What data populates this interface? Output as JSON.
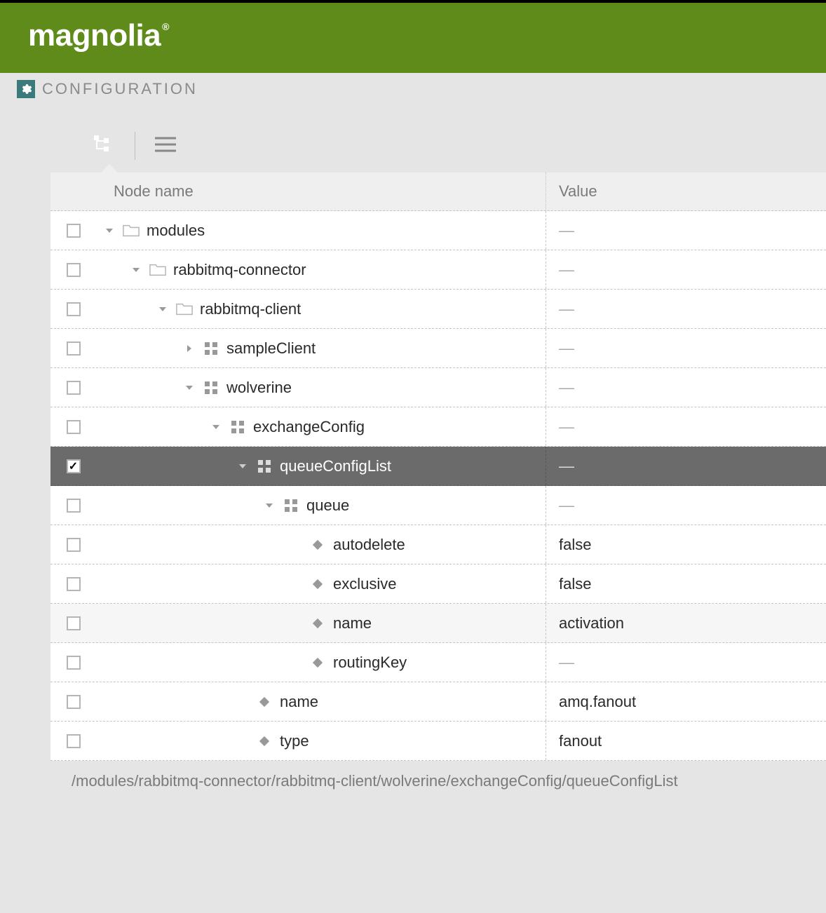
{
  "header": {
    "brand": "magnolia",
    "section_title": "CONFIGURATION"
  },
  "columns": {
    "node": "Node name",
    "value": "Value"
  },
  "rows": [
    {
      "indent": 0,
      "caret": "down",
      "icon": "folder",
      "label": "modules",
      "value": null,
      "checked": false,
      "alt": false
    },
    {
      "indent": 1,
      "caret": "down",
      "icon": "folder",
      "label": "rabbitmq-connector",
      "value": null,
      "checked": false,
      "alt": false
    },
    {
      "indent": 2,
      "caret": "down",
      "icon": "folder",
      "label": "rabbitmq-client",
      "value": null,
      "checked": false,
      "alt": false
    },
    {
      "indent": 3,
      "caret": "right",
      "icon": "content",
      "label": "sampleClient",
      "value": null,
      "checked": false,
      "alt": false
    },
    {
      "indent": 3,
      "caret": "down",
      "icon": "content",
      "label": "wolverine",
      "value": null,
      "checked": false,
      "alt": false
    },
    {
      "indent": 4,
      "caret": "down",
      "icon": "content",
      "label": "exchangeConfig",
      "value": null,
      "checked": false,
      "alt": false
    },
    {
      "indent": 5,
      "caret": "down",
      "icon": "content",
      "label": "queueConfigList",
      "value": null,
      "checked": true,
      "alt": false,
      "selected": true
    },
    {
      "indent": 6,
      "caret": "down",
      "icon": "content",
      "label": "queue",
      "value": null,
      "checked": false,
      "alt": false
    },
    {
      "indent": 7,
      "caret": "none",
      "icon": "prop",
      "label": "autodelete",
      "value": "false",
      "checked": false,
      "alt": false
    },
    {
      "indent": 7,
      "caret": "none",
      "icon": "prop",
      "label": "exclusive",
      "value": "false",
      "checked": false,
      "alt": false
    },
    {
      "indent": 7,
      "caret": "none",
      "icon": "prop",
      "label": "name",
      "value": "activation",
      "checked": false,
      "alt": true
    },
    {
      "indent": 7,
      "caret": "none",
      "icon": "prop",
      "label": "routingKey",
      "value": null,
      "checked": false,
      "alt": false
    },
    {
      "indent": 5,
      "caret": "none",
      "icon": "prop",
      "label": "name",
      "value": "amq.fanout",
      "checked": false,
      "alt": false
    },
    {
      "indent": 5,
      "caret": "none",
      "icon": "prop",
      "label": "type",
      "value": "fanout",
      "checked": false,
      "alt": false
    }
  ],
  "footer_path": "/modules/rabbitmq-connector/rabbitmq-client/wolverine/exchangeConfig/queueConfigList"
}
